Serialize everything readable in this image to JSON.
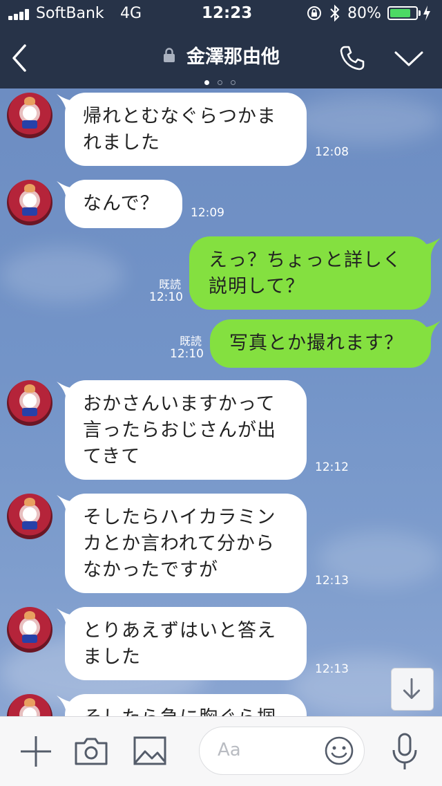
{
  "status_bar": {
    "carrier": "SoftBank",
    "network": "4G",
    "time": "12:23",
    "battery_percent_label": "80%",
    "battery_level": 0.8
  },
  "header": {
    "title": "金澤那由他",
    "page_indicator": {
      "count": 3,
      "active": 0
    }
  },
  "messages": [
    {
      "side": "in",
      "lines": [
        "帰れとむなぐらつかま",
        "れました"
      ],
      "time": "12:08"
    },
    {
      "side": "in",
      "lines": [
        "なんで？"
      ],
      "time": "12:09"
    },
    {
      "side": "out",
      "lines": [
        "えっ？ちょっと詳しく",
        "説明して？"
      ],
      "time": "12:10",
      "read": "既読"
    },
    {
      "side": "out",
      "lines": [
        "写真とか撮れます？"
      ],
      "time": "12:10",
      "read": "既読"
    },
    {
      "side": "in",
      "lines": [
        "おかさんいますかって",
        "言ったらおじさんが出",
        "てきて"
      ],
      "time": "12:12"
    },
    {
      "side": "in",
      "lines": [
        "そしたらハイカラミン",
        "カとか言われて分から",
        "なかったですが"
      ],
      "time": "12:13"
    },
    {
      "side": "in",
      "lines": [
        "とりあえずはいと答え",
        "ました"
      ],
      "time": "12:13"
    },
    {
      "side": "in",
      "lines": [
        "そしたら急に胸ぐら掴"
      ],
      "time": ""
    }
  ],
  "composer": {
    "placeholder": "Aa"
  },
  "icons": {
    "back": "chevron-left-icon",
    "call": "phone-icon",
    "menu": "chevron-down-icon",
    "add": "plus-icon",
    "camera": "camera-icon",
    "image": "image-icon",
    "emoji": "smile-icon",
    "voice": "microphone-icon",
    "scroll": "arrow-down-icon"
  },
  "colors": {
    "header_bg": "#273348",
    "outgoing_bubble": "#84e040",
    "incoming_bubble": "#ffffff",
    "battery_fill": "#4cd964"
  }
}
